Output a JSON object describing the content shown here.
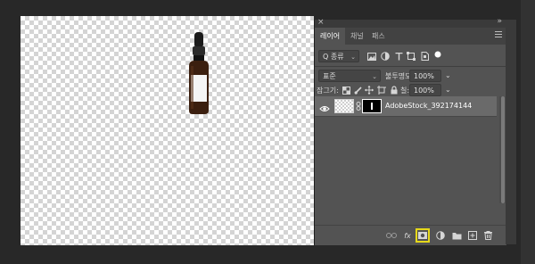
{
  "panel": {
    "close_icon": "×",
    "collapse_icon": "»",
    "tabs": [
      {
        "label": "레이어",
        "active": true
      },
      {
        "label": "채널",
        "active": false
      },
      {
        "label": "패스",
        "active": false
      }
    ],
    "filter": {
      "kind_label": "Q 종류",
      "icons": [
        "image-filter-icon",
        "adjustment-filter-icon",
        "type-filter-icon",
        "shape-filter-icon",
        "smart-object-filter-icon",
        "filter-toggle-icon"
      ]
    },
    "blend": {
      "mode": "표준",
      "opacity_label": "불투명도:",
      "opacity_value": "100%"
    },
    "lock": {
      "label": "잠그기:",
      "fill_label": "칠:",
      "fill_value": "100%",
      "icons": [
        "lock-transparent-icon",
        "lock-image-icon",
        "lock-position-icon",
        "lock-artboard-icon",
        "lock-all-icon"
      ]
    },
    "layers": [
      {
        "name": "AdobeStock_392174144",
        "visible": true,
        "selected": true
      }
    ],
    "footer_icons": [
      "link-layers-icon",
      "fx-icon",
      "add-mask-icon",
      "adjustment-layer-icon",
      "group-folder-icon",
      "new-layer-icon",
      "delete-layer-icon"
    ],
    "fx_label": "fx"
  },
  "colors": {
    "panel_bg": "#535353",
    "selected_row": "#6a6a6a",
    "highlight": "#e6d81a"
  }
}
